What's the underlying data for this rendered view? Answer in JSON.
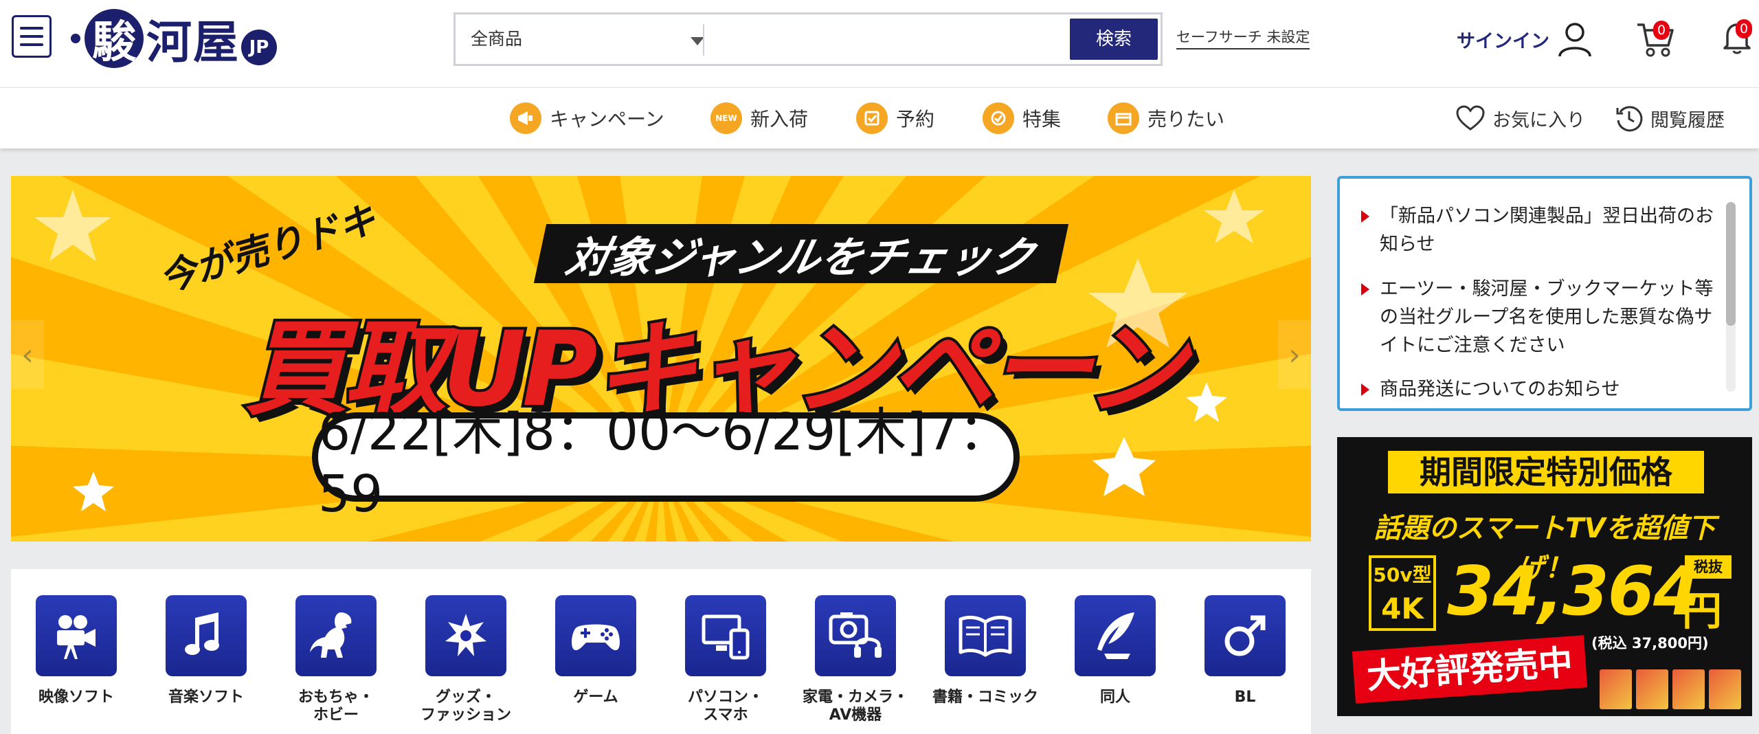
{
  "header": {
    "logo": {
      "circle_char": "駿",
      "rest": "河屋",
      "badge": "JP"
    },
    "search": {
      "category": "全商品",
      "placeholder": "",
      "button": "検索"
    },
    "safe_search": "セーフサーチ 未設定",
    "signin": "サインイン",
    "cart_count": "0",
    "notification_count": "0"
  },
  "nav": {
    "items": [
      {
        "label": "キャンペーン",
        "icon": "megaphone-icon"
      },
      {
        "label": "新入荷",
        "icon": "new-badge-icon"
      },
      {
        "label": "予約",
        "icon": "reserve-icon"
      },
      {
        "label": "特集",
        "icon": "feature-badge-icon"
      },
      {
        "label": "売りたい",
        "icon": "sell-box-icon"
      }
    ],
    "favorites": "お気に入り",
    "history": "閲覧履歴"
  },
  "banner": {
    "small": "今が売りドキ",
    "tag": "対象ジャンルをチェック",
    "title": "買取UPキャンペーン",
    "date": "6/22[木]8：00〜6/29[木]7：59"
  },
  "notices": [
    "「新品パソコン関連製品」翌日出荷のお知らせ",
    "エーツー・駿河屋・ブックマーケット等の当社グループ名を使用した悪質な偽サイトにご注意ください",
    "商品発送についてのお知らせ"
  ],
  "promo": {
    "headline": "期間限定特別価格",
    "subline": "話題のスマートTVを超値下げ！",
    "size": "50v型",
    "resolution": "4K",
    "price": "34,364",
    "unit": "円",
    "tax_excluded": "税抜",
    "tax_included": "(税込 37,800円)",
    "sale_text": "大好評発売中"
  },
  "categories": [
    {
      "label": "映像ソフト",
      "icon": "movie-camera-icon"
    },
    {
      "label": "音楽ソフト",
      "icon": "music-note-icon"
    },
    {
      "label": "おもちゃ・\nホビー",
      "icon": "dinosaur-icon"
    },
    {
      "label": "グッズ・\nファッション",
      "icon": "star-badge-icon"
    },
    {
      "label": "ゲーム",
      "icon": "gamepad-icon"
    },
    {
      "label": "パソコン・\nスマホ",
      "icon": "computer-phone-icon"
    },
    {
      "label": "家電・カメラ・\nAV機器",
      "icon": "camera-headphones-icon"
    },
    {
      "label": "書籍・コミック",
      "icon": "open-book-icon"
    },
    {
      "label": "同人",
      "icon": "quill-pen-icon"
    },
    {
      "label": "BL",
      "icon": "male-symbol-icon"
    }
  ],
  "colors": {
    "brand_navy": "#1c1f6b",
    "search_button": "#24287b",
    "accent_orange": "#f5a623",
    "notice_border": "#3ea0d8",
    "category_tile": "#1f2ba4",
    "badge_red": "#e60012"
  }
}
